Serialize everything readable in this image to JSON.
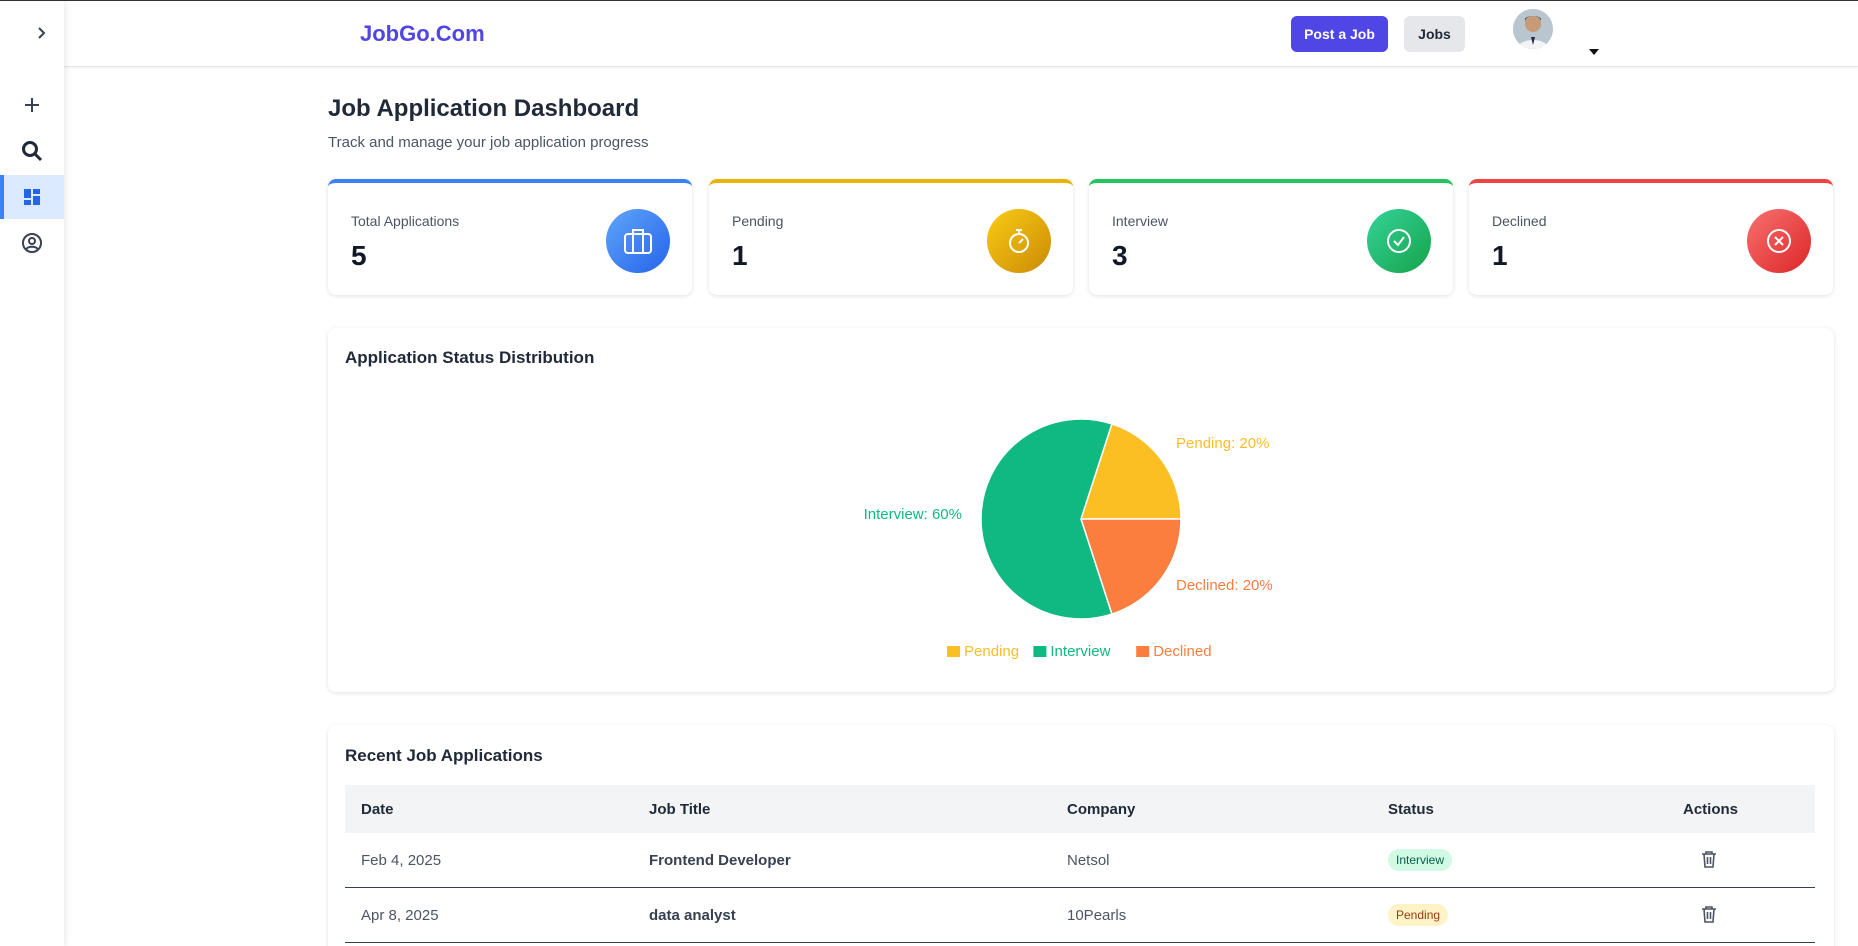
{
  "brand": "JobGo.Com",
  "header": {
    "post_job_label": "Post a Job",
    "jobs_label": "Jobs"
  },
  "sidebar": {
    "items": [
      "add-icon",
      "search-icon",
      "dashboard-icon",
      "profile-icon"
    ]
  },
  "page": {
    "title": "Job Application Dashboard",
    "subtitle": "Track and manage your job application progress"
  },
  "stats": [
    {
      "label": "Total Applications",
      "value": "5",
      "color": "#3b82f6"
    },
    {
      "label": "Pending",
      "value": "1",
      "color": "#eab308"
    },
    {
      "label": "Interview",
      "value": "3",
      "color": "#22c55e"
    },
    {
      "label": "Declined",
      "value": "1",
      "color": "#ef4444"
    }
  ],
  "chart_card": {
    "title": "Application Status Distribution"
  },
  "chart_data": {
    "type": "pie",
    "slices": [
      {
        "name": "Pending",
        "value": 20,
        "label": "Pending: 20%",
        "color": "#fbbf24"
      },
      {
        "name": "Interview",
        "value": 60,
        "label": "Interview: 60%",
        "color": "#10b981"
      },
      {
        "name": "Declined",
        "value": 20,
        "label": "Declined: 20%",
        "color": "#fb7e3f"
      }
    ],
    "legend": [
      "Pending",
      "Interview",
      "Declined"
    ],
    "legend_position": "bottom"
  },
  "table_card": {
    "title": "Recent Job Applications",
    "columns": [
      "Date",
      "Job Title",
      "Company",
      "Status",
      "Actions"
    ],
    "rows": [
      {
        "date": "Feb 4, 2025",
        "title": "Frontend Developer",
        "company": "Netsol",
        "status": "Interview"
      },
      {
        "date": "Apr 8, 2025",
        "title": "data analyst",
        "company": "10Pearls",
        "status": "Pending"
      }
    ]
  }
}
